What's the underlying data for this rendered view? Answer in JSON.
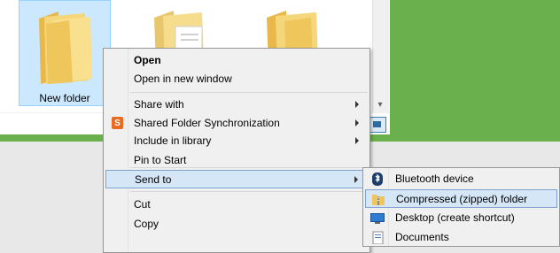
{
  "explorer": {
    "folders": [
      {
        "label": "New folder",
        "selected": true
      },
      {
        "label": "",
        "selected": false
      },
      {
        "label": "",
        "selected": false
      }
    ],
    "scroll_down_glyph": "▾",
    "colors": {
      "selection_fill": "#cce8ff",
      "selection_border": "#99d1ff",
      "frame_green": "#6ab04c"
    }
  },
  "context_menu": {
    "items": [
      {
        "label": "Open",
        "bold": true
      },
      {
        "label": "Open in new window"
      },
      {
        "label": "Share with",
        "submenu": true
      },
      {
        "label": "Shared Folder Synchronization",
        "submenu": true,
        "icon": "sync-icon",
        "icon_glyph": "S"
      },
      {
        "label": "Include in library",
        "submenu": true
      },
      {
        "label": "Pin to Start"
      },
      {
        "label": "Send to",
        "submenu": true,
        "highlighted": true
      },
      {
        "label": "Cut"
      },
      {
        "label": "Copy"
      }
    ]
  },
  "send_to_menu": {
    "items": [
      {
        "label": "Bluetooth device",
        "icon": "bluetooth-icon"
      },
      {
        "label": "Compressed (zipped) folder",
        "icon": "zip-folder-icon",
        "highlighted": true
      },
      {
        "label": "Desktop (create shortcut)",
        "icon": "desktop-icon"
      },
      {
        "label": "Documents",
        "icon": "documents-icon"
      }
    ]
  }
}
